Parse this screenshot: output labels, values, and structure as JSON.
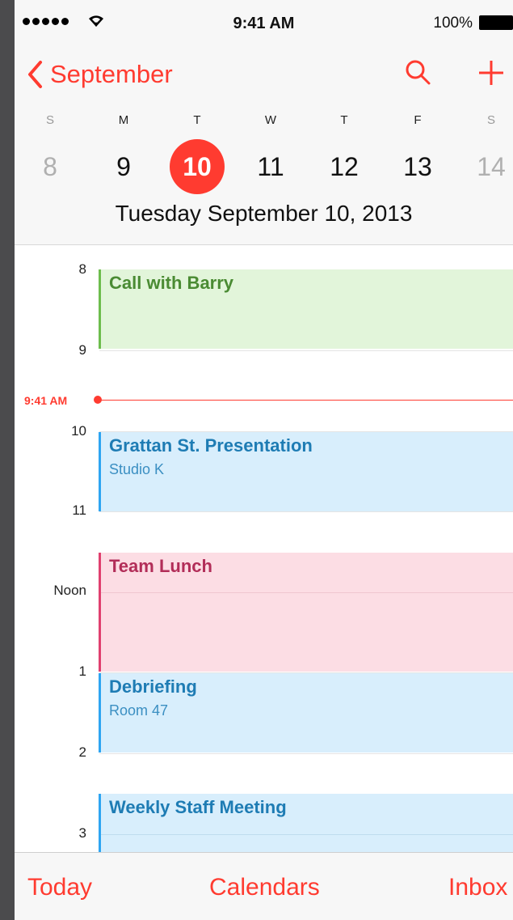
{
  "status_bar": {
    "time": "9:41 AM",
    "battery_percent": "100%",
    "signal_icon": "signal-dots-icon",
    "wifi_icon": "wifi-icon"
  },
  "header": {
    "back_label": "September",
    "back_icon": "chevron-left-icon",
    "search_icon": "search-icon",
    "add_icon": "plus-icon",
    "weekdays": [
      "S",
      "M",
      "T",
      "W",
      "T",
      "F",
      "S"
    ],
    "dates": [
      "8",
      "9",
      "10",
      "11",
      "12",
      "13",
      "14"
    ],
    "selected_index": 2,
    "full_date": "Tuesday September 10, 2013"
  },
  "timeline": {
    "hours": [
      "8",
      "9",
      "10",
      "11",
      "Noon",
      "1",
      "2",
      "3"
    ],
    "now_label": "9:41 AM",
    "events": [
      {
        "title": "Call with Barry",
        "subtitle": ""
      },
      {
        "title": "Grattan St. Presentation",
        "subtitle": "Studio K"
      },
      {
        "title": "Team Lunch",
        "subtitle": ""
      },
      {
        "title": "Debriefing",
        "subtitle": "Room 47"
      },
      {
        "title": "Weekly Staff Meeting",
        "subtitle": ""
      }
    ]
  },
  "toolbar": {
    "today": "Today",
    "calendars": "Calendars",
    "inbox": "Inbox"
  },
  "colors": {
    "accent": "#ff3b30",
    "event_green": "#e2f5da",
    "event_blue": "#d8eefc",
    "event_pink": "#fcdde4"
  }
}
